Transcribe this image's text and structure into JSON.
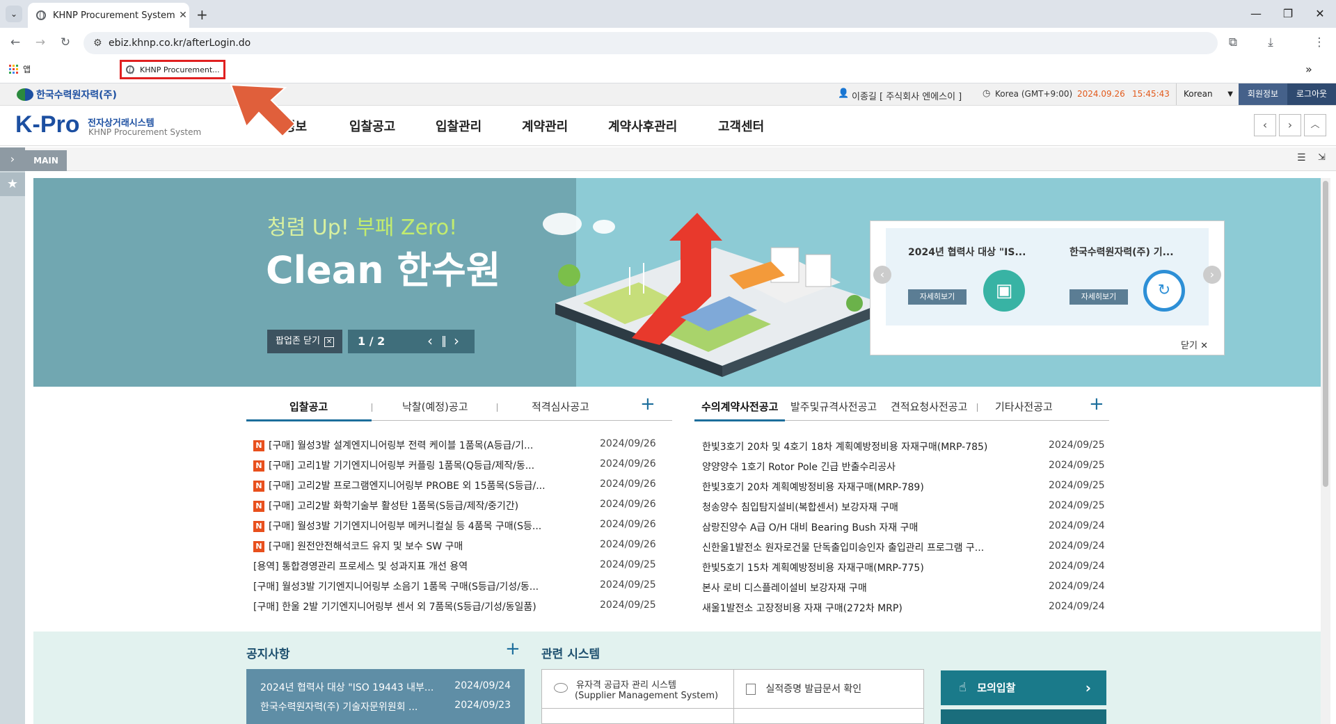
{
  "browser": {
    "tab_title": "KHNP Procurement System",
    "url": "ebiz.khnp.co.kr/afterLogin.do",
    "bookmark_apps": "앱",
    "bookmark_item": "KHNP Procurement..."
  },
  "site": {
    "logo_company": "한국수력원자력(주)",
    "logo_kpro": "K-Pro",
    "logo_sub_ko": "전자상거래시스템",
    "logo_sub_en": "KHNP Procurement System",
    "user": "이종길 [ 주식회사 엔에스이 ]",
    "timezone": "Korea (GMT+9:00)",
    "date": "2024.09.26",
    "time": "15:45:43",
    "language": "Korean",
    "member_info": "회원정보",
    "logout": "로그아웃",
    "menu": [
      "정보",
      "입찰공고",
      "입찰관리",
      "계약관리",
      "계약사후관리",
      "고객센터"
    ],
    "main_tab": "MAIN"
  },
  "banner": {
    "slogan1": "청렴 Up!",
    "slogan2": "부패 Zero!",
    "headline": "Clean 한수원",
    "close_popup": "팝업존 닫기",
    "page": "1 / 2",
    "cards": [
      {
        "title": "2024년 협력사 대상 \"IS...",
        "more": "자세히보기"
      },
      {
        "title": "한국수력원자력(주) 기...",
        "more": "자세히보기"
      }
    ],
    "close": "닫기"
  },
  "left_panel": {
    "tabs": [
      "입찰공고",
      "낙찰(예정)공고",
      "적격심사공고"
    ],
    "items": [
      {
        "new": true,
        "text": "[구매] 월성3발 설계엔지니어링부 전력 케이블 1품목(A등급/기...",
        "date": "2024/09/26"
      },
      {
        "new": true,
        "text": "[구매] 고리1발 기기엔지니어링부 커플링 1품목(Q등급/제작/동...",
        "date": "2024/09/26"
      },
      {
        "new": true,
        "text": "[구매] 고리2발 프로그램엔지니어링부 PROBE 외 15품목(S등급/...",
        "date": "2024/09/26"
      },
      {
        "new": true,
        "text": "[구매] 고리2발 화학기술부 활성탄 1품목(S등급/제작/중기간)",
        "date": "2024/09/26"
      },
      {
        "new": true,
        "text": "[구매] 월성3발 기기엔지니어링부 메커니컬실 등 4품목 구매(S등...",
        "date": "2024/09/26"
      },
      {
        "new": true,
        "text": "[구매] 원전안전해석코드 유지 및 보수 SW 구매",
        "date": "2024/09/26"
      },
      {
        "new": false,
        "text": "[용역] 통합경영관리 프로세스 및 성과지표 개선 용역",
        "date": "2024/09/25"
      },
      {
        "new": false,
        "text": "[구매] 월성3발 기기엔지니어링부 소음기 1품목 구매(S등급/기성/동...",
        "date": "2024/09/25"
      },
      {
        "new": false,
        "text": "[구매] 한울 2발 기기엔지니어링부 센서 외 7품목(S등급/기성/동일품)",
        "date": "2024/09/25"
      }
    ]
  },
  "right_panel": {
    "tabs": [
      "수의계약사전공고",
      "발주및규격사전공고",
      "견적요청사전공고",
      "기타사전공고"
    ],
    "items": [
      {
        "text": "한빛3호기 20차 및 4호기 18차 계획예방정비용 자재구매(MRP-785)",
        "date": "2024/09/25"
      },
      {
        "text": "양양양수 1호기 Rotor Pole 긴급 반출수리공사",
        "date": "2024/09/25"
      },
      {
        "text": "한빛3호기 20차 계획예방정비용 자재구매(MRP-789)",
        "date": "2024/09/25"
      },
      {
        "text": "청송양수 침입탐지설비(복합센서) 보강자재 구매",
        "date": "2024/09/25"
      },
      {
        "text": "삼랑진양수 A급 O/H 대비 Bearing Bush 자재 구매",
        "date": "2024/09/24"
      },
      {
        "text": "신한울1발전소 원자로건물 단독출입미승인자 출입관리 프로그램 구...",
        "date": "2024/09/24"
      },
      {
        "text": "한빛5호기 15차 계획예방정비용 자재구매(MRP-775)",
        "date": "2024/09/24"
      },
      {
        "text": "본사 로비 디스플레이설비 보강자재 구매",
        "date": "2024/09/24"
      },
      {
        "text": "새울1발전소 고장정비용 자재 구매(272차 MRP)",
        "date": "2024/09/24"
      }
    ]
  },
  "notice": {
    "title": "공지사항",
    "items": [
      {
        "text": "2024년 협력사 대상 \"ISO 19443 내부...",
        "date": "2024/09/24"
      },
      {
        "text": "한국수력원자력(주) 기술자문위원회 ...",
        "date": "2024/09/23"
      }
    ]
  },
  "related": {
    "title": "관련 시스템",
    "sms": "유자격 공급자 관리 시스템",
    "sms_en": "(Supplier Management System)",
    "cert": "실적증명 발급문서 확인",
    "mock": "모의입찰"
  }
}
